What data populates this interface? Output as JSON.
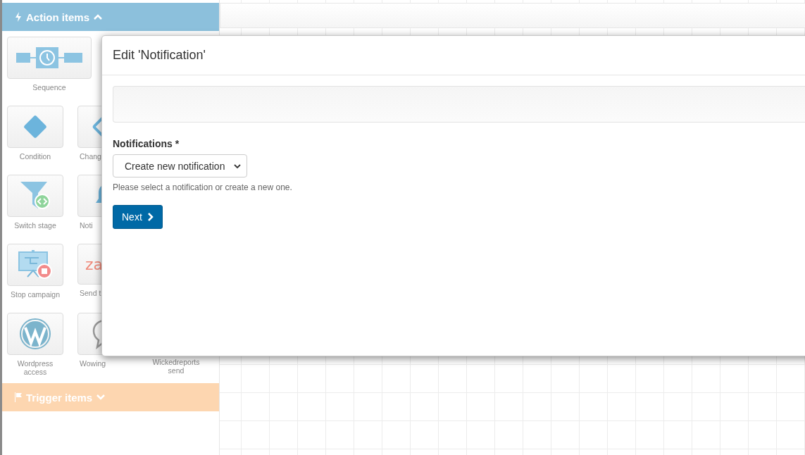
{
  "sidebar": {
    "sections": [
      {
        "title": "Action items",
        "kind": "action",
        "expanded": true,
        "rows": [
          [
            {
              "label": "Sequence",
              "kind": "sequence"
            }
          ],
          [
            {
              "label": "Condition",
              "kind": "condition"
            },
            {
              "label": "Chang",
              "kind": "change"
            }
          ],
          [
            {
              "label": "Switch stage",
              "kind": "switch"
            },
            {
              "label": "Noti",
              "kind": "notify"
            }
          ],
          [
            {
              "label": "Stop campaign",
              "kind": "stop"
            },
            {
              "label": "Send t",
              "kind": "logo",
              "logo_text": "za"
            }
          ],
          [
            {
              "label": "Wordpress access",
              "kind": "wordpress"
            },
            {
              "label": "Wowing",
              "kind": "chat"
            },
            {
              "label": "Wickedreports send",
              "kind": "covered"
            }
          ]
        ]
      },
      {
        "title": "Trigger items",
        "kind": "trigger",
        "expanded": false
      }
    ]
  },
  "dialog": {
    "title": "Edit 'Notification'",
    "field_label": "Notifications *",
    "select_value": "Create new notification",
    "help": "Please select a notification or create a new one.",
    "button": "Next"
  }
}
